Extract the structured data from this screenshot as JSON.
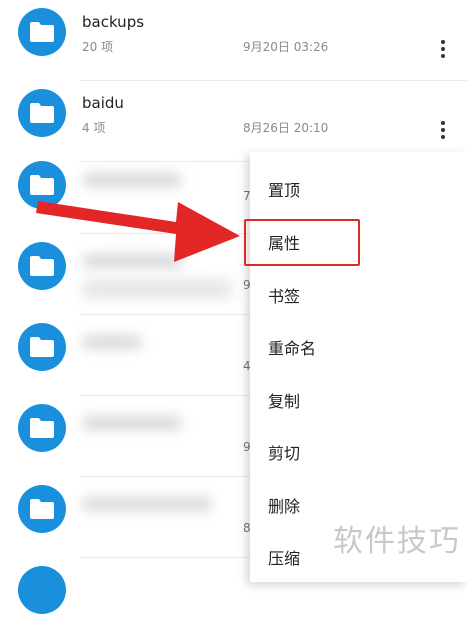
{
  "files": [
    {
      "name": "backups",
      "count": "20 项",
      "date": "9月20日 03:26"
    },
    {
      "name": "baidu",
      "count": "4 项",
      "date": "8月26日 20:10"
    }
  ],
  "blurred_rows": [
    {
      "peek": "7"
    },
    {
      "peek": "9"
    },
    {
      "peek": "4"
    },
    {
      "peek": "9"
    },
    {
      "peek": "8"
    }
  ],
  "context_menu": {
    "items": [
      "置顶",
      "属性",
      "书签",
      "重命名",
      "复制",
      "剪切",
      "删除",
      "压缩"
    ],
    "highlighted": "属性"
  },
  "icons": {
    "folder": "folder-icon",
    "more": "more-vertical-icon"
  },
  "colors": {
    "folder": "#1a8fdb",
    "highlight": "#e02a2a",
    "arrow": "#e32626"
  },
  "watermark": "软件技巧"
}
